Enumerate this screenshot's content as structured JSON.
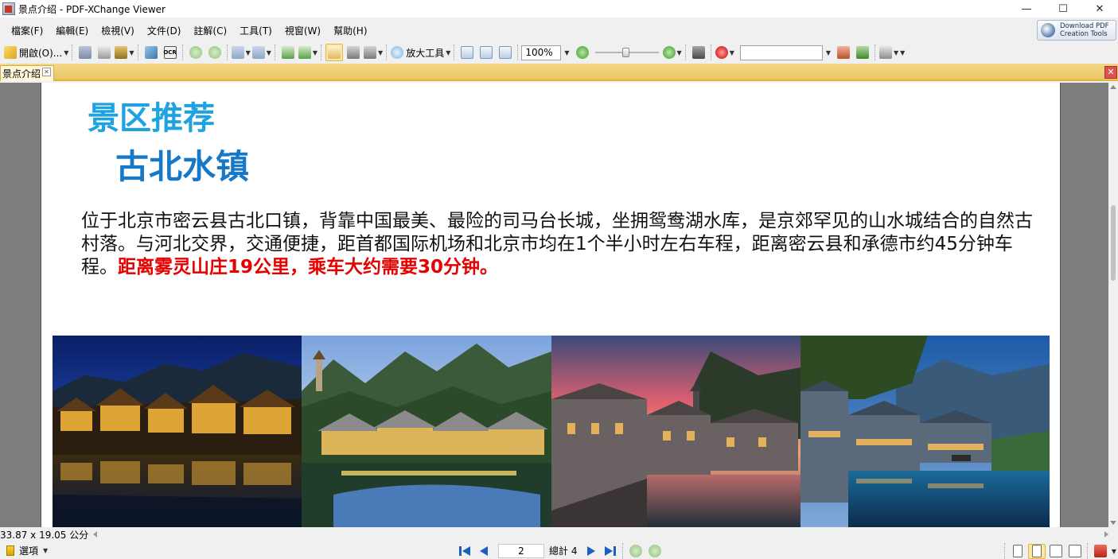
{
  "window": {
    "title": "景点介绍 - PDF-XChange Viewer",
    "controls": {
      "minimize": "—",
      "maximize": "☐",
      "close": "✕"
    }
  },
  "menubar": {
    "items": [
      "檔案(F)",
      "編輯(E)",
      "檢視(V)",
      "文件(D)",
      "註解(C)",
      "工具(T)",
      "視窗(W)",
      "幫助(H)"
    ],
    "download_label_line1": "Download PDF",
    "download_label_line2": "Creation Tools"
  },
  "toolbar": {
    "open_label": "開啟(O)...",
    "ocr_label": "OCR",
    "zoom_tool_label": "放大工具",
    "zoom_value": "100%",
    "search_value": "",
    "active_tool": "hand-tool"
  },
  "tabs": {
    "document_tab": "景点介绍",
    "close_glyph": "✕"
  },
  "document": {
    "heading": "景区推荐",
    "subheading": "古北水镇",
    "body_text": "位于北京市密云县古北口镇，背靠中国最美、最险的司马台长城，坐拥鸳鸯湖水库，是京郊罕见的山水城结合的自然古村落。与河北交界，交通便捷，距首都国际机场和北京市均在1个半小时左右车程，距离密云县和承德市约45分钟车程。",
    "highlight_text": "距离雾灵山庄19公里，乘车大约需要30分钟。",
    "colors": {
      "heading": "#1fa2e0",
      "subheading": "#1778c8",
      "highlight": "#e60000"
    },
    "photos": [
      "night-water-town-photo",
      "mountain-town-photo",
      "sunset-canal-photo",
      "evening-canal-photo"
    ]
  },
  "status": {
    "page_size": "33.87 x 19.05 公分"
  },
  "bottombar": {
    "options_label": "選項",
    "current_page": "2",
    "total_label": "總計 4"
  }
}
